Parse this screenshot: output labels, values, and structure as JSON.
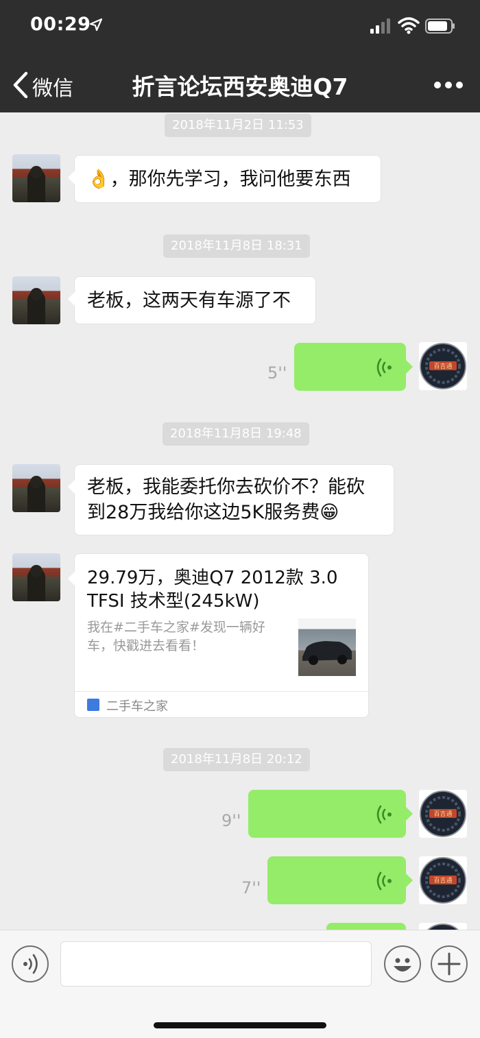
{
  "status_bar": {
    "time": "00:29"
  },
  "nav": {
    "back_label": "微信",
    "title": "折言论坛西安奥迪Q7"
  },
  "messages": {
    "ts1": "2018年11月2日 11:53",
    "m1_emoji": "👌",
    "m1_text": "，那你先学习，我问他要东西",
    "ts2": "2018年11月8日 18:31",
    "m2_text": "老板，这两天有车源了不",
    "v1_duration": "5''",
    "ts3": "2018年11月8日 19:48",
    "m3_line1": "老板，我能委托你去砍价不？能砍",
    "m3_line2": "到28万我给你这边5K服务费",
    "m3_emoji": "😁",
    "card": {
      "title": "29.79万，奥迪Q7 2012款 3.0 TFSI 技术型(245kW)",
      "desc": "我在#二手车之家#发现一辆好车，快戳进去看看！",
      "source": "二手车之家"
    },
    "ts4": "2018年11月8日 20:12",
    "v2_duration": "9''",
    "v3_duration": "7''"
  },
  "avatar_me_label": "百吉通",
  "icons": {
    "back": "chevron-left-icon",
    "more": "more-dots-icon",
    "voice": "voice-wave-icon",
    "voice_input": "voice-input-icon",
    "emoji": "emoji-smile-icon",
    "plus": "plus-icon"
  },
  "colors": {
    "header": "#2e2e2e",
    "chat_bg": "#ededed",
    "sent_bubble": "#95ec69",
    "received_bubble": "#ffffff"
  }
}
